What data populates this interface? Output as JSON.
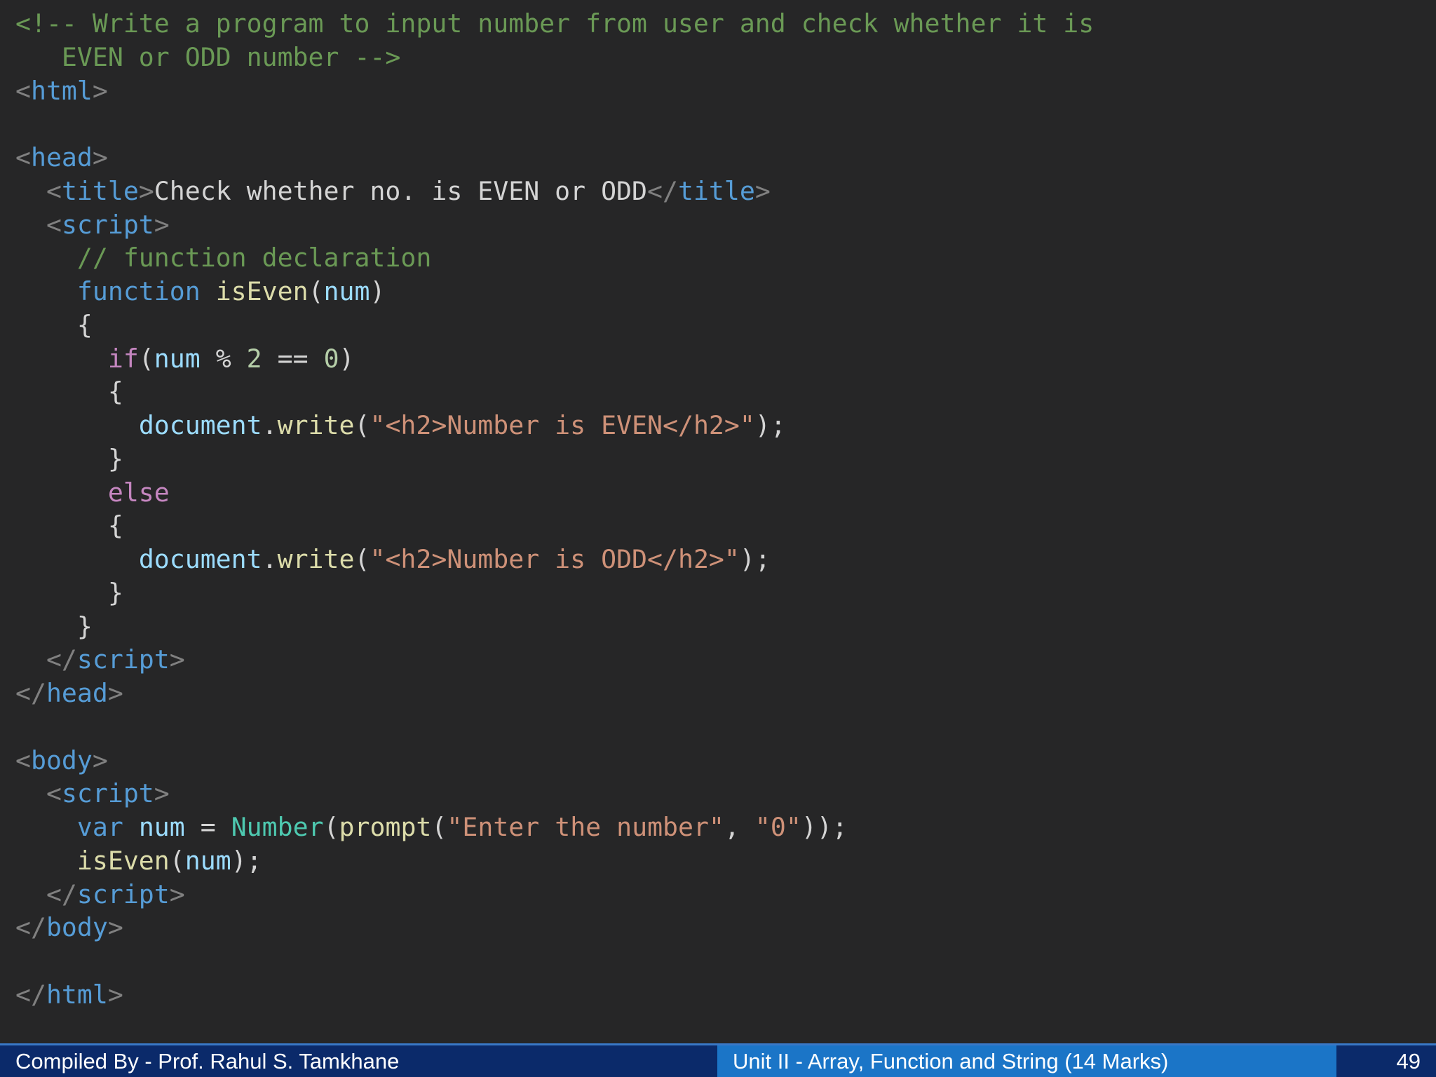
{
  "code": {
    "language": "html",
    "lines": [
      [
        {
          "t": "<!-- Write a program to input number from user and check whether it is",
          "c": "comment"
        }
      ],
      [
        {
          "t": "   EVEN or ODD number -->",
          "c": "comment"
        }
      ],
      [
        {
          "t": "<",
          "c": "punct"
        },
        {
          "t": "html",
          "c": "tag"
        },
        {
          "t": ">",
          "c": "punct"
        }
      ],
      [],
      [
        {
          "t": "<",
          "c": "punct"
        },
        {
          "t": "head",
          "c": "tag"
        },
        {
          "t": ">",
          "c": "punct"
        }
      ],
      [
        {
          "t": "  <",
          "c": "punct"
        },
        {
          "t": "title",
          "c": "tag"
        },
        {
          "t": ">",
          "c": "punct"
        },
        {
          "t": "Check whether no. is EVEN or ODD",
          "c": "text"
        },
        {
          "t": "</",
          "c": "punct"
        },
        {
          "t": "title",
          "c": "tag"
        },
        {
          "t": ">",
          "c": "punct"
        }
      ],
      [
        {
          "t": "  <",
          "c": "punct"
        },
        {
          "t": "script",
          "c": "tag"
        },
        {
          "t": ">",
          "c": "punct"
        }
      ],
      [
        {
          "t": "    // function declaration",
          "c": "comment"
        }
      ],
      [
        {
          "t": "    ",
          "c": "text"
        },
        {
          "t": "function",
          "c": "kw"
        },
        {
          "t": " ",
          "c": "text"
        },
        {
          "t": "isEven",
          "c": "fn"
        },
        {
          "t": "(",
          "c": "text"
        },
        {
          "t": "num",
          "c": "var"
        },
        {
          "t": ")",
          "c": "text"
        }
      ],
      [
        {
          "t": "    {",
          "c": "text"
        }
      ],
      [
        {
          "t": "      ",
          "c": "text"
        },
        {
          "t": "if",
          "c": "ctrl"
        },
        {
          "t": "(",
          "c": "text"
        },
        {
          "t": "num",
          "c": "var"
        },
        {
          "t": " % ",
          "c": "text"
        },
        {
          "t": "2",
          "c": "num"
        },
        {
          "t": " == ",
          "c": "text"
        },
        {
          "t": "0",
          "c": "num"
        },
        {
          "t": ")",
          "c": "text"
        }
      ],
      [
        {
          "t": "      {",
          "c": "text"
        }
      ],
      [
        {
          "t": "        ",
          "c": "text"
        },
        {
          "t": "document",
          "c": "var"
        },
        {
          "t": ".",
          "c": "text"
        },
        {
          "t": "write",
          "c": "fn"
        },
        {
          "t": "(",
          "c": "text"
        },
        {
          "t": "\"<h2>Number is EVEN</h2>\"",
          "c": "str"
        },
        {
          "t": ");",
          "c": "text"
        }
      ],
      [
        {
          "t": "      }",
          "c": "text"
        }
      ],
      [
        {
          "t": "      ",
          "c": "text"
        },
        {
          "t": "else",
          "c": "ctrl"
        }
      ],
      [
        {
          "t": "      {",
          "c": "text"
        }
      ],
      [
        {
          "t": "        ",
          "c": "text"
        },
        {
          "t": "document",
          "c": "var"
        },
        {
          "t": ".",
          "c": "text"
        },
        {
          "t": "write",
          "c": "fn"
        },
        {
          "t": "(",
          "c": "text"
        },
        {
          "t": "\"<h2>Number is ODD</h2>\"",
          "c": "str"
        },
        {
          "t": ");",
          "c": "text"
        }
      ],
      [
        {
          "t": "      }",
          "c": "text"
        }
      ],
      [
        {
          "t": "    }",
          "c": "text"
        }
      ],
      [
        {
          "t": "  </",
          "c": "punct"
        },
        {
          "t": "script",
          "c": "tag"
        },
        {
          "t": ">",
          "c": "punct"
        }
      ],
      [
        {
          "t": "</",
          "c": "punct"
        },
        {
          "t": "head",
          "c": "tag"
        },
        {
          "t": ">",
          "c": "punct"
        }
      ],
      [],
      [
        {
          "t": "<",
          "c": "punct"
        },
        {
          "t": "body",
          "c": "tag"
        },
        {
          "t": ">",
          "c": "punct"
        }
      ],
      [
        {
          "t": "  <",
          "c": "punct"
        },
        {
          "t": "script",
          "c": "tag"
        },
        {
          "t": ">",
          "c": "punct"
        }
      ],
      [
        {
          "t": "    ",
          "c": "text"
        },
        {
          "t": "var",
          "c": "kw"
        },
        {
          "t": " ",
          "c": "text"
        },
        {
          "t": "num",
          "c": "var"
        },
        {
          "t": " = ",
          "c": "text"
        },
        {
          "t": "Number",
          "c": "type"
        },
        {
          "t": "(",
          "c": "text"
        },
        {
          "t": "prompt",
          "c": "fn"
        },
        {
          "t": "(",
          "c": "text"
        },
        {
          "t": "\"Enter the number\"",
          "c": "str"
        },
        {
          "t": ", ",
          "c": "text"
        },
        {
          "t": "\"0\"",
          "c": "str"
        },
        {
          "t": "));",
          "c": "text"
        }
      ],
      [
        {
          "t": "    ",
          "c": "text"
        },
        {
          "t": "isEven",
          "c": "fn"
        },
        {
          "t": "(",
          "c": "text"
        },
        {
          "t": "num",
          "c": "var"
        },
        {
          "t": ");",
          "c": "text"
        }
      ],
      [
        {
          "t": "  </",
          "c": "punct"
        },
        {
          "t": "script",
          "c": "tag"
        },
        {
          "t": ">",
          "c": "punct"
        }
      ],
      [
        {
          "t": "</",
          "c": "punct"
        },
        {
          "t": "body",
          "c": "tag"
        },
        {
          "t": ">",
          "c": "punct"
        }
      ],
      [],
      [
        {
          "t": "</",
          "c": "punct"
        },
        {
          "t": "html",
          "c": "tag"
        },
        {
          "t": ">",
          "c": "punct"
        }
      ]
    ]
  },
  "footer": {
    "author": "Compiled By - Prof. Rahul S. Tamkhane",
    "unit": "Unit II - Array, Function and String (14 Marks)",
    "page_number": "49"
  },
  "colors": {
    "background": "#262627",
    "comment": "#6a9955",
    "tag": "#569cd6",
    "string": "#ce9178",
    "footer_dark": "#0b2a6a",
    "footer_mid": "#1b75c7"
  }
}
